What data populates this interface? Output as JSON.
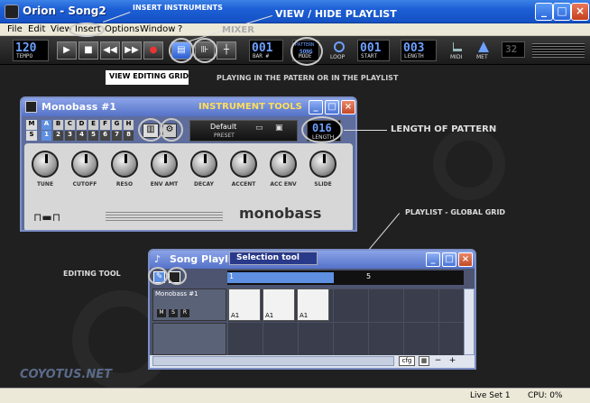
{
  "app": {
    "title": "Orion - Song2"
  },
  "menu": [
    "File",
    "Edit",
    "View",
    "Insert",
    "Options",
    "Window",
    "?"
  ],
  "transport": {
    "tempo": {
      "value": "120",
      "label": "TEMPO"
    },
    "bar": {
      "value": "001",
      "label": "BAR #"
    },
    "mode": {
      "top": "PATTERN",
      "mid": "SONG",
      "label": "MODE"
    },
    "loop_label": "LOOP",
    "start": {
      "value": "001",
      "label": "START"
    },
    "length": {
      "value": "003",
      "label": "LENGTH"
    },
    "midi_label": "MIDI",
    "met_label": "MET",
    "num_display": "32"
  },
  "annotations": {
    "insert_instruments": "INSERT INSTRUMENTS",
    "view_hide_playlist": "VIEW / HIDE PLAYLIST",
    "mixer": "MIXER",
    "playing_mode": "PLAYING IN THE PATERN OR IN THE PLAYLIST",
    "view_editing_grid": "VIEW EDITING GRID",
    "instrument_tools": "INSTRUMENT TOOLS",
    "length_of_pattern": "LENGTH OF PATTERN",
    "playlist_global_grid": "PLAYLIST - GLOBAL GRID",
    "editing_tool": "EDITING TOOL",
    "selection_tool": "Selection tool",
    "watermark": "COYOTUS.NET"
  },
  "monobass": {
    "title": "Monobass #1",
    "ms": [
      "M",
      "S"
    ],
    "letters": [
      "A",
      "B",
      "C",
      "D",
      "E",
      "F",
      "G",
      "H"
    ],
    "numbers": [
      "1",
      "2",
      "3",
      "4",
      "5",
      "6",
      "7",
      "8"
    ],
    "preset": {
      "value": "Default",
      "label": "PRESET"
    },
    "length": {
      "value": "016",
      "label": "LENGTH"
    },
    "knobs": [
      "TUNE",
      "CUTOFF",
      "RESO",
      "ENV AMT",
      "DECAY",
      "ACCENT",
      "ACC ENV",
      "SLIDE"
    ],
    "brand": "monobass"
  },
  "playlist": {
    "title": "Song Playlist",
    "ruler_marks": [
      "1",
      "5"
    ],
    "track_name": "Monobass #1",
    "track_buttons": [
      "M",
      "S",
      "R"
    ],
    "clip_label": "A1",
    "cfg_label": "cfg"
  },
  "status": {
    "live_set": "Live Set 1",
    "cpu": "CPU: 0%"
  }
}
